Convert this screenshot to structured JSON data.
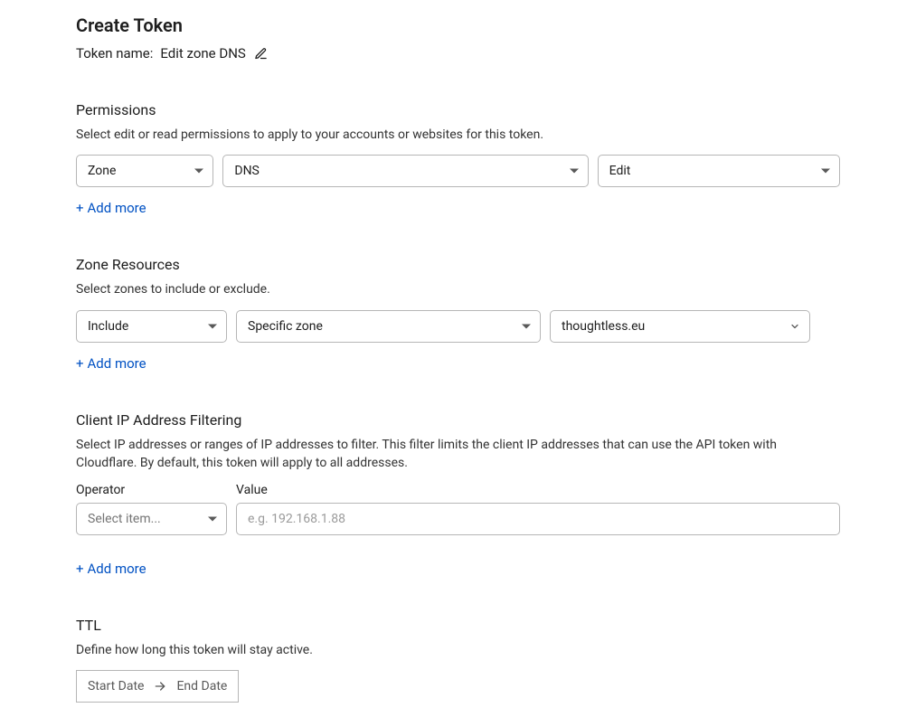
{
  "page": {
    "title": "Create Token",
    "tokenNameLabel": "Token name:",
    "tokenNameValue": "Edit zone DNS"
  },
  "permissions": {
    "title": "Permissions",
    "desc": "Select edit or read permissions to apply to your accounts or websites for this token.",
    "scope": "Zone",
    "resource": "DNS",
    "level": "Edit",
    "addMore": "Add more"
  },
  "zoneResources": {
    "title": "Zone Resources",
    "desc": "Select zones to include or exclude.",
    "mode": "Include",
    "scope": "Specific zone",
    "zone": "thoughtless.eu",
    "addMore": "Add more"
  },
  "ipFilter": {
    "title": "Client IP Address Filtering",
    "desc": "Select IP addresses or ranges of IP addresses to filter. This filter limits the client IP addresses that can use the API token with Cloudflare. By default, this token will apply to all addresses.",
    "operatorLabel": "Operator",
    "valueLabel": "Value",
    "operatorPlaceholder": "Select item...",
    "valuePlaceholder": "e.g. 192.168.1.88",
    "addMore": "Add more"
  },
  "ttl": {
    "title": "TTL",
    "desc": "Define how long this token will stay active.",
    "startLabel": "Start Date",
    "endLabel": "End Date"
  }
}
